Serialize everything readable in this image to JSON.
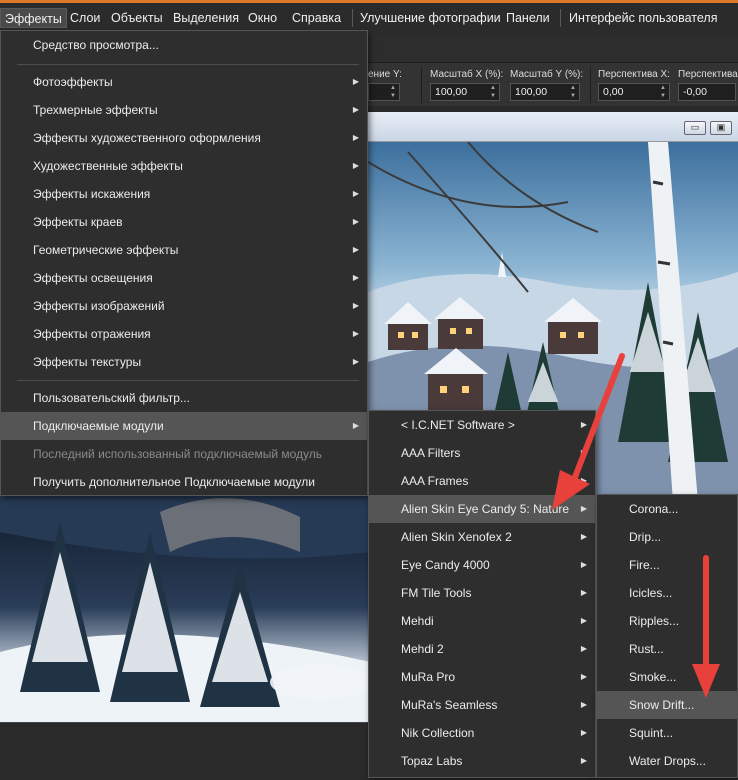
{
  "menubar": {
    "items": [
      "Эффекты",
      "Слои",
      "Объекты",
      "Выделения",
      "Окно",
      "Справка",
      "Улучшение фотографии",
      "Панели",
      "Интерфейс пользователя"
    ]
  },
  "toolbar": {
    "fields": [
      {
        "label": "ение Y:",
        "value": ""
      },
      {
        "label": "Масштаб X (%):",
        "value": "100,00"
      },
      {
        "label": "Масштаб Y (%):",
        "value": "100,00"
      },
      {
        "label": "Перспектива X:",
        "value": "0,00"
      },
      {
        "label": "Перспектива",
        "value": "-0,00"
      }
    ]
  },
  "window_buttons": {
    "minimize": "▭",
    "maximize": "▣"
  },
  "effects_menu": {
    "items": [
      "Средство просмотра...",
      "Фотоэффекты",
      "Трехмерные эффекты",
      "Эффекты художественного оформления",
      "Художественные эффекты",
      "Эффекты искажения",
      "Эффекты краев",
      "Геометрические эффекты",
      "Эффекты освещения",
      "Эффекты изображений",
      "Эффекты отражения",
      "Эффекты текстуры",
      "Пользовательский фильтр...",
      "Подключаемые модули",
      "Последний использованный подключаемый модуль",
      "Получить дополнительное Подключаемые модули"
    ]
  },
  "plugins_menu": {
    "items": [
      "< I.C.NET Software >",
      "AAA Filters",
      "AAA Frames",
      "Alien Skin Eye Candy 5: Nature",
      "Alien Skin Xenofex 2",
      "Eye Candy 4000",
      "FM Tile Tools",
      "Mehdi",
      "Mehdi 2",
      "MuRa Pro",
      "MuRa's Seamless",
      "Nik Collection",
      "Topaz Labs"
    ]
  },
  "nature_menu": {
    "items": [
      "Corona...",
      "Drip...",
      "Fire...",
      "Icicles...",
      "Ripples...",
      "Rust...",
      "Smoke...",
      "Snow Drift...",
      "Squint...",
      "Water Drops..."
    ]
  },
  "colors": {
    "accent": "#e0782a",
    "arrow": "#e8403a",
    "highlight": "#555555"
  }
}
